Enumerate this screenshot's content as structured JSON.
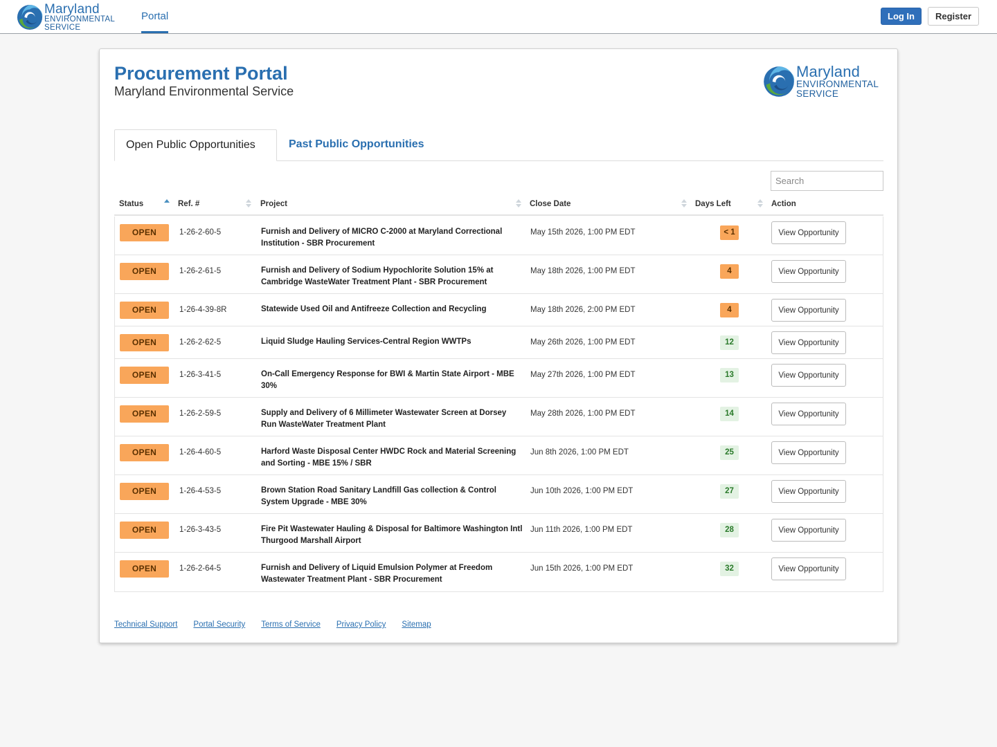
{
  "brand": {
    "line1": "Maryland",
    "line2": "ENVIRONMENTAL",
    "line3": "SERVICE",
    "primary_color": "#2a6fb0"
  },
  "nav": {
    "portal_label": "Portal",
    "login_label": "Log In",
    "register_label": "Register"
  },
  "page": {
    "title": "Procurement Portal",
    "subtitle": "Maryland Environmental Service"
  },
  "tabs": [
    {
      "label": "Open Public Opportunities",
      "active": true
    },
    {
      "label": "Past Public Opportunities",
      "active": false
    }
  ],
  "search": {
    "placeholder": "Search",
    "value": ""
  },
  "table": {
    "headers": {
      "status": "Status",
      "ref": "Ref. #",
      "project": "Project",
      "close_date": "Close Date",
      "days_left": "Days Left",
      "action": "Action"
    },
    "rows": [
      {
        "status": "OPEN",
        "ref": "1-26-2-60-5",
        "project": "Furnish and Delivery of MICRO C-2000 at Maryland Correctional Institution - SBR Procurement",
        "close_date": "May 15th 2026, 1:00 PM EDT",
        "days_left": "< 1",
        "urgent": true,
        "action": "View Opportunity"
      },
      {
        "status": "OPEN",
        "ref": "1-26-2-61-5",
        "project": "Furnish and Delivery of Sodium Hypochlorite Solution 15% at Cambridge WasteWater Treatment Plant - SBR Procurement",
        "close_date": "May 18th 2026, 1:00 PM EDT",
        "days_left": "4",
        "urgent": true,
        "action": "View Opportunity"
      },
      {
        "status": "OPEN",
        "ref": "1-26-4-39-8R",
        "project": "Statewide Used Oil and Antifreeze Collection and Recycling",
        "close_date": "May 18th 2026, 2:00 PM EDT",
        "days_left": "4",
        "urgent": true,
        "action": "View Opportunity"
      },
      {
        "status": "OPEN",
        "ref": "1-26-2-62-5",
        "project": "Liquid Sludge Hauling Services-Central Region WWTPs",
        "close_date": "May 26th 2026, 1:00 PM EDT",
        "days_left": "12",
        "urgent": false,
        "action": "View Opportunity"
      },
      {
        "status": "OPEN",
        "ref": "1-26-3-41-5",
        "project": "On-Call Emergency Response for BWI & Martin State Airport - MBE 30%",
        "close_date": "May 27th 2026, 1:00 PM EDT",
        "days_left": "13",
        "urgent": false,
        "action": "View Opportunity"
      },
      {
        "status": "OPEN",
        "ref": "1-26-2-59-5",
        "project": "Supply and Delivery of 6 Millimeter Wastewater Screen at Dorsey Run WasteWater Treatment Plant",
        "close_date": "May 28th 2026, 1:00 PM EDT",
        "days_left": "14",
        "urgent": false,
        "action": "View Opportunity"
      },
      {
        "status": "OPEN",
        "ref": "1-26-4-60-5",
        "project": "Harford Waste Disposal Center HWDC Rock and Material Screening and Sorting - MBE 15% / SBR",
        "close_date": "Jun 8th 2026, 1:00 PM EDT",
        "days_left": "25",
        "urgent": false,
        "action": "View Opportunity"
      },
      {
        "status": "OPEN",
        "ref": "1-26-4-53-5",
        "project": "Brown Station Road Sanitary Landfill Gas collection & Control System Upgrade - MBE 30%",
        "close_date": "Jun 10th 2026, 1:00 PM EDT",
        "days_left": "27",
        "urgent": false,
        "action": "View Opportunity"
      },
      {
        "status": "OPEN",
        "ref": "1-26-3-43-5",
        "project": "Fire Pit Wastewater Hauling & Disposal for Baltimore Washington Intl Thurgood Marshall Airport",
        "close_date": "Jun 11th 2026, 1:00 PM EDT",
        "days_left": "28",
        "urgent": false,
        "action": "View Opportunity"
      },
      {
        "status": "OPEN",
        "ref": "1-26-2-64-5",
        "project": "Furnish and Delivery of Liquid Emulsion Polymer at Freedom Wastewater Treatment Plant - SBR Procurement",
        "close_date": "Jun 15th 2026, 1:00 PM EDT",
        "days_left": "32",
        "urgent": false,
        "action": "View Opportunity"
      }
    ]
  },
  "footer": {
    "links": [
      "Technical Support",
      "Portal Security",
      "Terms of Service",
      "Privacy Policy",
      "Sitemap"
    ]
  }
}
